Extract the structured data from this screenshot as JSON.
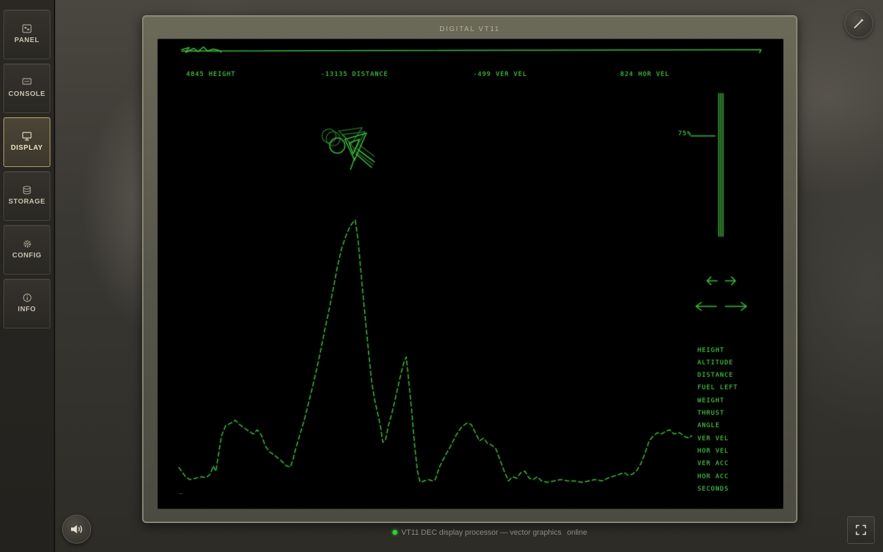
{
  "sidebar": {
    "pause_label": "II",
    "items": [
      {
        "label": "PANEL",
        "icon": "panel-icon",
        "active": false
      },
      {
        "label": "CONSOLE",
        "icon": "console-icon",
        "active": false
      },
      {
        "label": "DISPLAY",
        "icon": "monitor-icon",
        "active": true
      },
      {
        "label": "STORAGE",
        "icon": "storage-icon",
        "active": false
      },
      {
        "label": "CONFIG",
        "icon": "gear-icon",
        "active": false
      },
      {
        "label": "INFO",
        "icon": "info-icon",
        "active": false
      }
    ]
  },
  "frame": {
    "title": "DIGITAL VT11"
  },
  "display": {
    "readouts": {
      "height": "4845 HEIGHT",
      "distance": "-13135 DISTANCE",
      "ver_vel": "-499 VER VEL",
      "hor_vel": "824 HOR VEL"
    },
    "fuel_gauge_label": "75%",
    "fuel_gauge_level": 0.75,
    "menu": [
      "HEIGHT",
      "ALTITUDE",
      "DISTANCE",
      "FUEL LEFT",
      "WEIGHT",
      "THRUST",
      "ANGLE",
      "VER VEL",
      "HOR VEL",
      "VER ACC",
      "HOR ACC",
      "SECONDS"
    ],
    "cursor": "_"
  },
  "status": {
    "text": "VT11 DEC display processor — vector graphics",
    "state": "online"
  },
  "colors": {
    "phosphor": "#43b043",
    "accent": "#b8a36a",
    "led": "#3bd13b"
  },
  "icons": {
    "top_right": "magic-wand-icon",
    "bottom_left": "speaker-icon",
    "bottom_right": "fullscreen-icon"
  }
}
